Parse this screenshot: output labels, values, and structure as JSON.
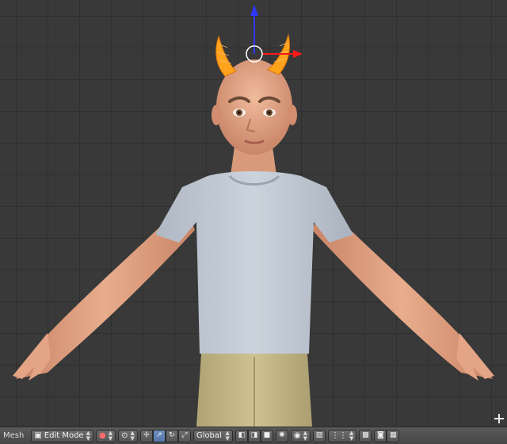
{
  "header": {
    "editor_type_label": "Mesh",
    "mode": {
      "label": "Edit Mode"
    },
    "transform_orientation": {
      "label": "Global"
    }
  },
  "icons": {
    "corner": "crosshair-icon",
    "mode": "cube-icon",
    "shading": "sphere-icon",
    "pivot": "pivot-icon",
    "manipulator": "axis-icon",
    "translate": "arrow-icon",
    "rotate": "rotate-icon",
    "scale": "scale-icon",
    "proportional": "ring-icon",
    "snap": "magnet-icon",
    "render": "camera-icon"
  },
  "colors": {
    "viewport_bg": "#393939",
    "grid_line": "#2f2f2f",
    "header_bg": "#4f4f4f",
    "selection": "#ffa21c",
    "axis_z": "#2f38ff",
    "axis_x": "#ff1a1a",
    "active_button": "#5478a8"
  }
}
